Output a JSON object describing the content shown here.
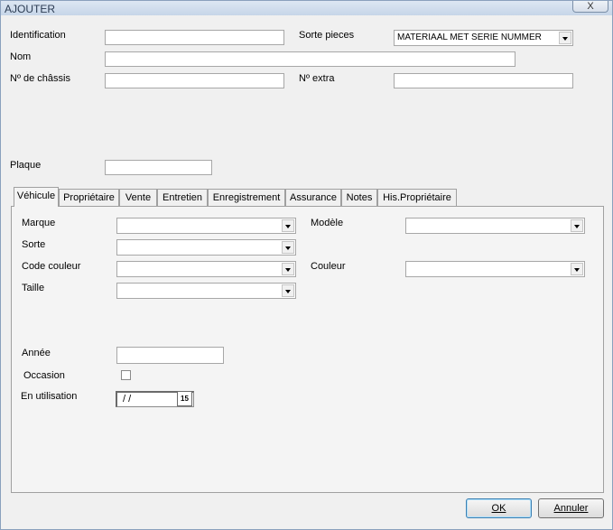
{
  "window": {
    "title": "AJOUTER",
    "close_glyph": "X"
  },
  "header_fields": {
    "identification": {
      "label": "Identification",
      "value": ""
    },
    "sorte_pieces": {
      "label": "Sorte pieces",
      "value": "MATERIAAL MET SERIE NUMMER"
    },
    "nom": {
      "label": "Nom",
      "value": ""
    },
    "chassis": {
      "label": "Nº de châssis",
      "value": ""
    },
    "extra": {
      "label": "Nº extra",
      "value": ""
    },
    "plaque": {
      "label": "Plaque",
      "value": ""
    }
  },
  "tabs": [
    {
      "label": "Véhicule",
      "active": true
    },
    {
      "label": "Propriétaire"
    },
    {
      "label": "Vente"
    },
    {
      "label": "Entretien"
    },
    {
      "label": "Enregistrement"
    },
    {
      "label": "Assurance"
    },
    {
      "label": "Notes"
    },
    {
      "label": "His.Propriétaire"
    }
  ],
  "vehicle": {
    "marque": {
      "label": "Marque",
      "value": ""
    },
    "modele": {
      "label": "Modèle",
      "value": ""
    },
    "sorte": {
      "label": "Sorte",
      "value": ""
    },
    "code_couleur": {
      "label": "Code couleur",
      "value": ""
    },
    "couleur": {
      "label": "Couleur",
      "value": ""
    },
    "taille": {
      "label": "Taille",
      "value": ""
    },
    "annee": {
      "label": "Année",
      "value": ""
    },
    "occasion": {
      "label": "Occasion",
      "checked": false
    },
    "en_utilisation": {
      "label": "En utilisation",
      "value": "/ /",
      "calendar_glyph": "15"
    }
  },
  "buttons": {
    "ok_label": "OK",
    "cancel_label": "Annuler"
  },
  "colors": {
    "window_bg": "#f0f0f0",
    "titlebar": "#c6d5e8",
    "field_border": "#a7a7a7"
  }
}
